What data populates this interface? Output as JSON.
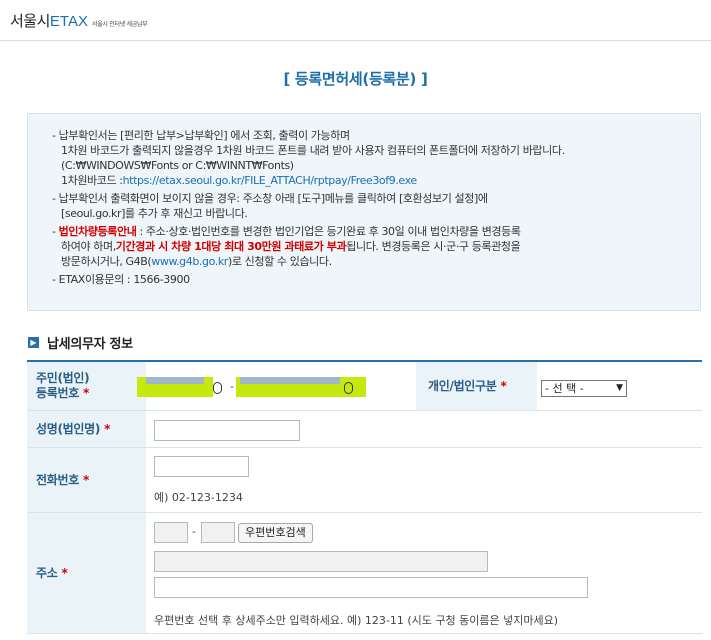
{
  "header": {
    "logo_main": "서울시",
    "logo_brand": "ETAX",
    "logo_sub": "서울시 인터넷 세금납부"
  },
  "page_title": "[ 등록면허세(등록분) ]",
  "notice": {
    "n1_l1": "납부확인서는 [편리한 납부>납부확인] 에서 조회, 출력이 가능하며",
    "n1_l2": "1차원 바코드가 출력되지 않을경우 1차원 바코드 폰트를 내려 받아 사용자 컴퓨터의 폰트폴더에 저장하기 바랍니다.",
    "n1_l3": "(C:₩WINDOWS₩Fonts or C:₩WINNT₩Fonts)",
    "n1_l4_label": "1차원바코드 :",
    "n1_l4_url": "https://etax.seoul.go.kr/FILE_ATTACH/rptpay/Free3of9.exe",
    "n2_l1": "납부확인서 출력화면이 보이지 않을 경우: 주소창 아래 [도구]메뉴를 클릭하여 [호환성보기 설정]에",
    "n2_l2": "[seoul.go.kr]를 추가 후 재신고 바랍니다.",
    "n3_red1": "법인차량등록안내",
    "n3_l1": " : 주소·상호·법인번호를 변경한 법인기업은 등기완료 후 30일 이내 법인차량을 변경등록",
    "n3_l2a": "하여야 하며,",
    "n3_red2": "기간경과 시 차량 1대당 최대 30만원 과태료가 부과",
    "n3_l2b": "됩니다. 변경등록은 시·군·구 등록관청을",
    "n3_l3a": "방문하시거나, G4B(",
    "n3_link": "www.g4b.go.kr",
    "n3_l3b": ")로 신청할 수 있습니다.",
    "n4": "ETAX이용문의 : 1566-3900"
  },
  "section": {
    "icon": "arrow-right-icon",
    "title": "납세의무자 정보"
  },
  "form": {
    "required_mark": "*",
    "rrn_label_1": "주민(법인)",
    "rrn_label_2": "등록번호",
    "rrn_dash": "-",
    "type_label": "개인/법인구분",
    "type_select": "- 선 택 -",
    "name_label": "성명(법인명)",
    "phone_label": "전화번호",
    "phone_example": "예) 02-123-1234",
    "addr_label": "주소",
    "zip_dash": "-",
    "zip_search_button": "우편번호검색",
    "addr_help": "우편번호 선택 후 상세주소만 입력하세요. 예) 123-11 (시도 구청 동이름은 넣지마세요)"
  },
  "colors": {
    "accent": "#1d6fa8",
    "required": "#d40000",
    "notice_bg": "#eef6fa",
    "label_bg": "#eaf3f8",
    "redaction": "#c5e80e"
  }
}
